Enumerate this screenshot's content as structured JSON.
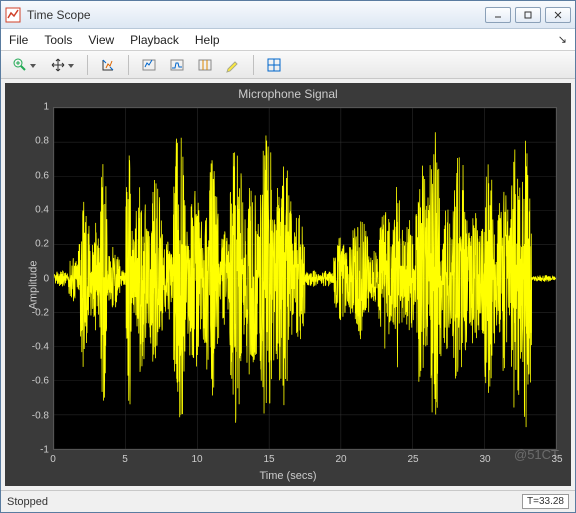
{
  "window": {
    "title": "Time Scope"
  },
  "menus": [
    "File",
    "Tools",
    "View",
    "Playback",
    "Help"
  ],
  "toolbar": {
    "zoom": "zoom-in-icon",
    "pan": "pan-arrows-icon",
    "autoscale": "autoscale-icon",
    "scale_x": "scale-x-icon",
    "scale_y": "scale-y-icon",
    "cursors": "cursor-measure-icon",
    "highlight": "highlight-icon",
    "layout": "layout-grid-icon"
  },
  "status": {
    "left": "Stopped",
    "time": "T=33.28"
  },
  "watermark": "@51CT",
  "chart_data": {
    "type": "line",
    "title": "Microphone Signal",
    "xlabel": "Time (secs)",
    "ylabel": "Amplitude",
    "xlim": [
      0,
      35
    ],
    "ylim": [
      -1,
      1
    ],
    "xticks": [
      0,
      5,
      10,
      15,
      20,
      25,
      30,
      35
    ],
    "yticks": [
      -1,
      -0.8,
      -0.6,
      -0.4,
      -0.2,
      0,
      0.2,
      0.4,
      0.6,
      0.8,
      1
    ],
    "xtick_labels": [
      "0",
      "5",
      "10",
      "15",
      "20",
      "25",
      "30",
      "35"
    ],
    "ytick_labels": [
      "-1",
      "-0.8",
      "-0.6",
      "-0.4",
      "-0.2",
      "0",
      "0.2",
      "0.4",
      "0.6",
      "0.8",
      "1"
    ],
    "series": [
      {
        "name": "Microphone Signal",
        "color": "#ffff00",
        "envelope_segments": [
          {
            "t0": 0.0,
            "t1": 1.0,
            "amp": 0.05
          },
          {
            "t0": 1.0,
            "t1": 1.7,
            "amp": 0.15
          },
          {
            "t0": 1.7,
            "t1": 2.5,
            "amp": 0.55
          },
          {
            "t0": 2.5,
            "t1": 3.2,
            "amp": 0.35
          },
          {
            "t0": 3.2,
            "t1": 3.7,
            "amp": 0.75
          },
          {
            "t0": 3.7,
            "t1": 4.6,
            "amp": 0.2
          },
          {
            "t0": 4.6,
            "t1": 5.0,
            "amp": 0.05
          },
          {
            "t0": 5.0,
            "t1": 5.4,
            "amp": 0.9
          },
          {
            "t0": 5.4,
            "t1": 6.6,
            "amp": 0.55
          },
          {
            "t0": 6.6,
            "t1": 7.6,
            "amp": 0.6
          },
          {
            "t0": 7.6,
            "t1": 8.3,
            "amp": 0.25
          },
          {
            "t0": 8.3,
            "t1": 9.2,
            "amp": 0.98
          },
          {
            "t0": 9.2,
            "t1": 10.4,
            "amp": 0.55
          },
          {
            "t0": 10.4,
            "t1": 11.5,
            "amp": 0.7
          },
          {
            "t0": 11.5,
            "t1": 12.2,
            "amp": 0.3
          },
          {
            "t0": 12.2,
            "t1": 13.2,
            "amp": 0.85
          },
          {
            "t0": 13.2,
            "t1": 14.3,
            "amp": 0.6
          },
          {
            "t0": 14.3,
            "t1": 15.4,
            "amp": 0.9
          },
          {
            "t0": 15.4,
            "t1": 16.6,
            "amp": 0.75
          },
          {
            "t0": 16.6,
            "t1": 17.5,
            "amp": 0.4
          },
          {
            "t0": 17.5,
            "t1": 18.5,
            "amp": 0.05
          },
          {
            "t0": 18.5,
            "t1": 19.5,
            "amp": 0.05
          },
          {
            "t0": 19.5,
            "t1": 20.5,
            "amp": 0.25
          },
          {
            "t0": 20.5,
            "t1": 22.0,
            "amp": 0.38
          },
          {
            "t0": 22.0,
            "t1": 22.6,
            "amp": 0.18
          },
          {
            "t0": 22.6,
            "t1": 23.6,
            "amp": 0.42
          },
          {
            "t0": 23.6,
            "t1": 24.3,
            "amp": 0.55
          },
          {
            "t0": 24.3,
            "t1": 25.2,
            "amp": 0.35
          },
          {
            "t0": 25.2,
            "t1": 26.0,
            "amp": 0.75
          },
          {
            "t0": 26.0,
            "t1": 27.0,
            "amp": 0.88
          },
          {
            "t0": 27.0,
            "t1": 27.8,
            "amp": 0.45
          },
          {
            "t0": 27.8,
            "t1": 28.8,
            "amp": 0.78
          },
          {
            "t0": 28.8,
            "t1": 29.8,
            "amp": 0.4
          },
          {
            "t0": 29.8,
            "t1": 30.8,
            "amp": 0.7
          },
          {
            "t0": 30.8,
            "t1": 31.8,
            "amp": 0.55
          },
          {
            "t0": 31.8,
            "t1": 32.6,
            "amp": 0.82
          },
          {
            "t0": 32.6,
            "t1": 33.3,
            "amp": 0.95
          },
          {
            "t0": 33.3,
            "t1": 35.0,
            "amp": 0.02
          }
        ]
      }
    ]
  }
}
